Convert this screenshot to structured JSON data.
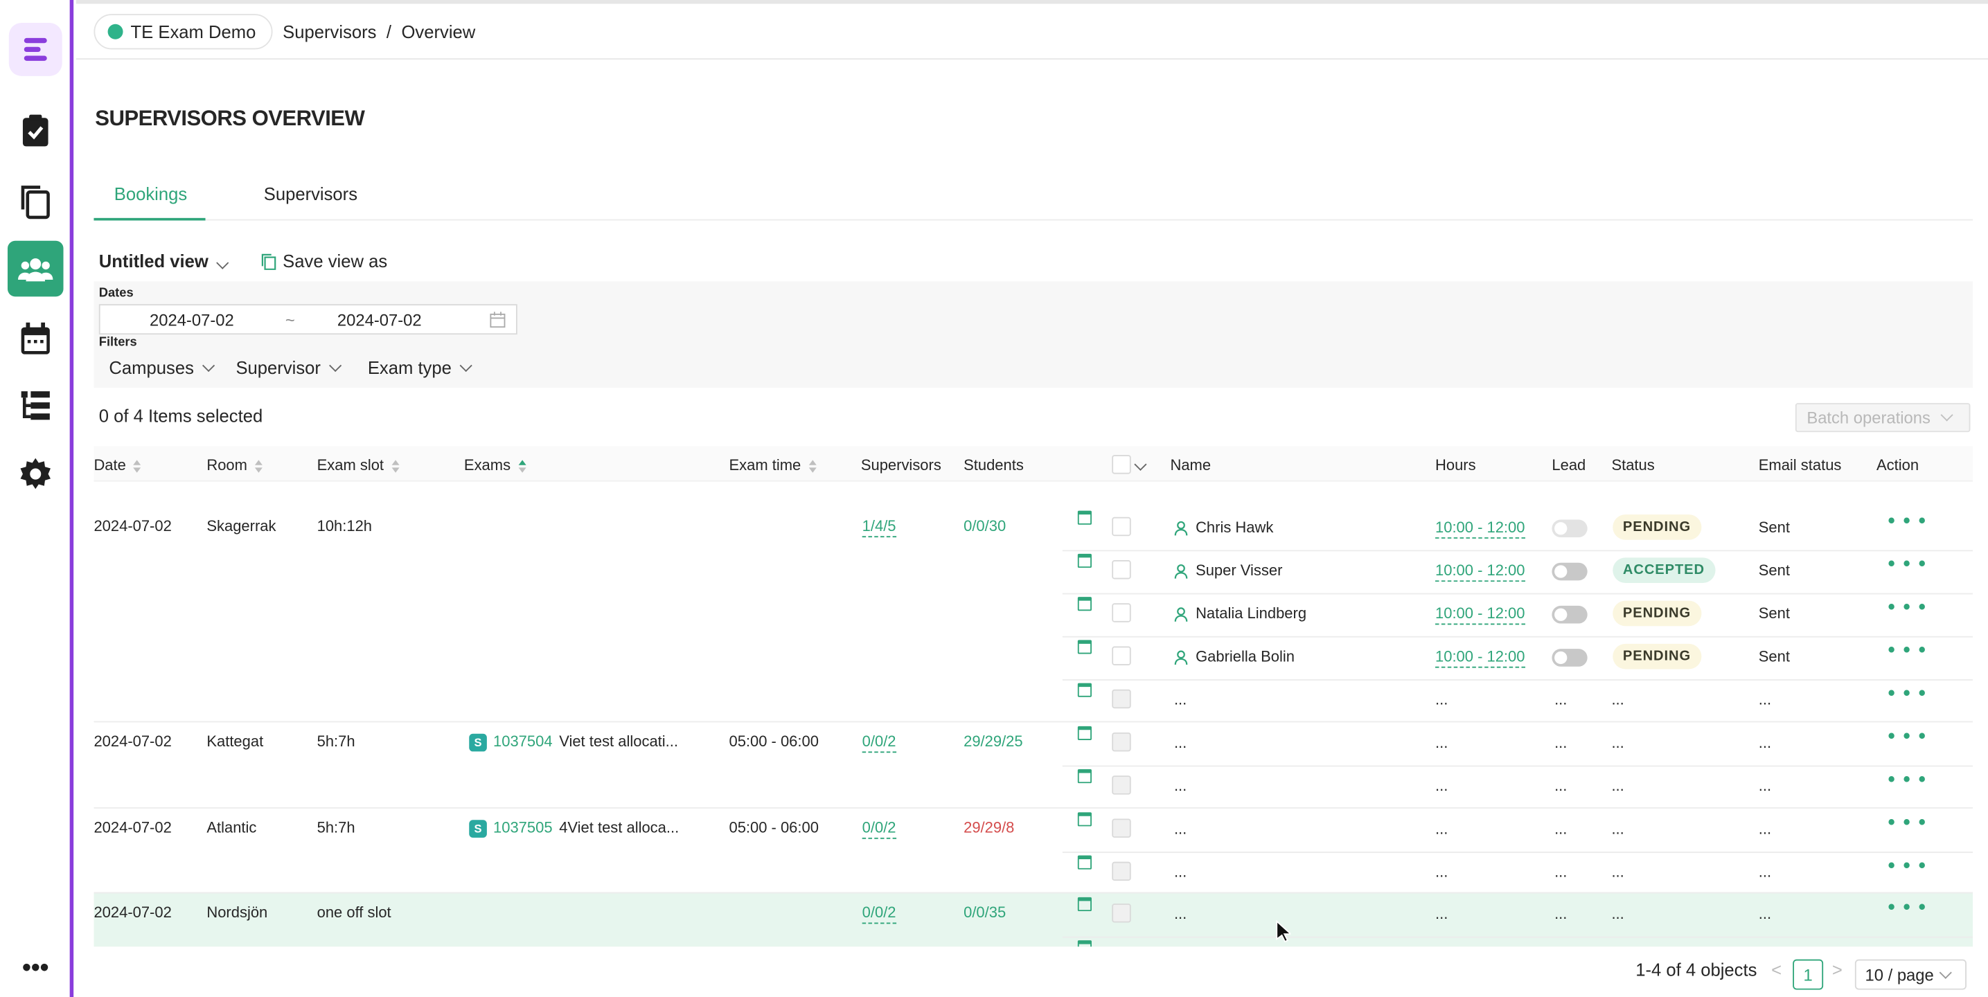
{
  "env": {
    "name": "TE Exam Demo"
  },
  "breadcrumb": {
    "part1": "Supervisors",
    "sep": "/",
    "part2": "Overview"
  },
  "page_title": "SUPERVISORS OVERVIEW",
  "tabs": [
    {
      "label": "Bookings"
    },
    {
      "label": "Supervisors"
    }
  ],
  "view": {
    "name": "Untitled view",
    "save_label": "Save view as"
  },
  "filters": {
    "dates_label": "Dates",
    "date_from": "2024-07-02",
    "date_sep": "~",
    "date_to": "2024-07-02",
    "filters_label": "Filters",
    "campuses": "Campuses",
    "supervisor": "Supervisor",
    "exam_type": "Exam type"
  },
  "selection": {
    "text": "0 of 4 Items selected",
    "batch_label": "Batch operations"
  },
  "columns": {
    "date": "Date",
    "room": "Room",
    "exam_slot": "Exam slot",
    "exams": "Exams",
    "exam_time": "Exam time",
    "supervisors": "Supervisors",
    "students": "Students",
    "name": "Name",
    "hours": "Hours",
    "lead": "Lead",
    "status": "Status",
    "email_status": "Email status",
    "action": "Action"
  },
  "rows": [
    {
      "date": "2024-07-02",
      "room": "Skagerrak",
      "slot": "10h:12h",
      "exam_id": "",
      "exam_name": "",
      "time": "",
      "supervisors": "1/4/5",
      "students": "0/0/30",
      "students_color": "green"
    },
    {
      "date": "2024-07-02",
      "room": "Kattegat",
      "slot": "5h:7h",
      "exam_badge": "S",
      "exam_id": "1037504",
      "exam_name": "Viet test allocati...",
      "time": "05:00 - 06:00",
      "supervisors": "0/0/2",
      "students": "29/29/25",
      "students_color": "green"
    },
    {
      "date": "2024-07-02",
      "room": "Atlantic",
      "slot": "5h:7h",
      "exam_badge": "S",
      "exam_id": "1037505",
      "exam_name": "4Viet test alloca...",
      "time": "05:00 - 06:00",
      "supervisors": "0/0/2",
      "students": "29/29/8",
      "students_color": "red"
    },
    {
      "date": "2024-07-02",
      "room": "Nordsjön",
      "slot": "one off slot",
      "exam_id": "",
      "exam_name": "",
      "time": "",
      "supervisors": "0/0/2",
      "students": "0/0/35",
      "students_color": "green"
    }
  ],
  "assignments": [
    {
      "name": "Chris Hawk",
      "hours": "10:00 - 12:00",
      "status": "PENDING",
      "email": "Sent"
    },
    {
      "name": "Super Visser",
      "hours": "10:00 - 12:00",
      "status": "ACCEPTED",
      "email": "Sent"
    },
    {
      "name": "Natalia Lindberg",
      "hours": "10:00 - 12:00",
      "status": "PENDING",
      "email": "Sent"
    },
    {
      "name": "Gabriella Bolin",
      "hours": "10:00 - 12:00",
      "status": "PENDING",
      "email": "Sent"
    }
  ],
  "placeholder": "...",
  "action_dots": "• • •",
  "pagination": {
    "summary": "1-4 of 4 objects",
    "page": "1",
    "per_page": "10 / page",
    "prev": "<",
    "next": ">"
  },
  "sidebar": {
    "more": "•••"
  },
  "colors": {
    "accent": "#2fa57a",
    "sidebar_border": "#8a3ddc",
    "danger": "#d44c4c"
  }
}
